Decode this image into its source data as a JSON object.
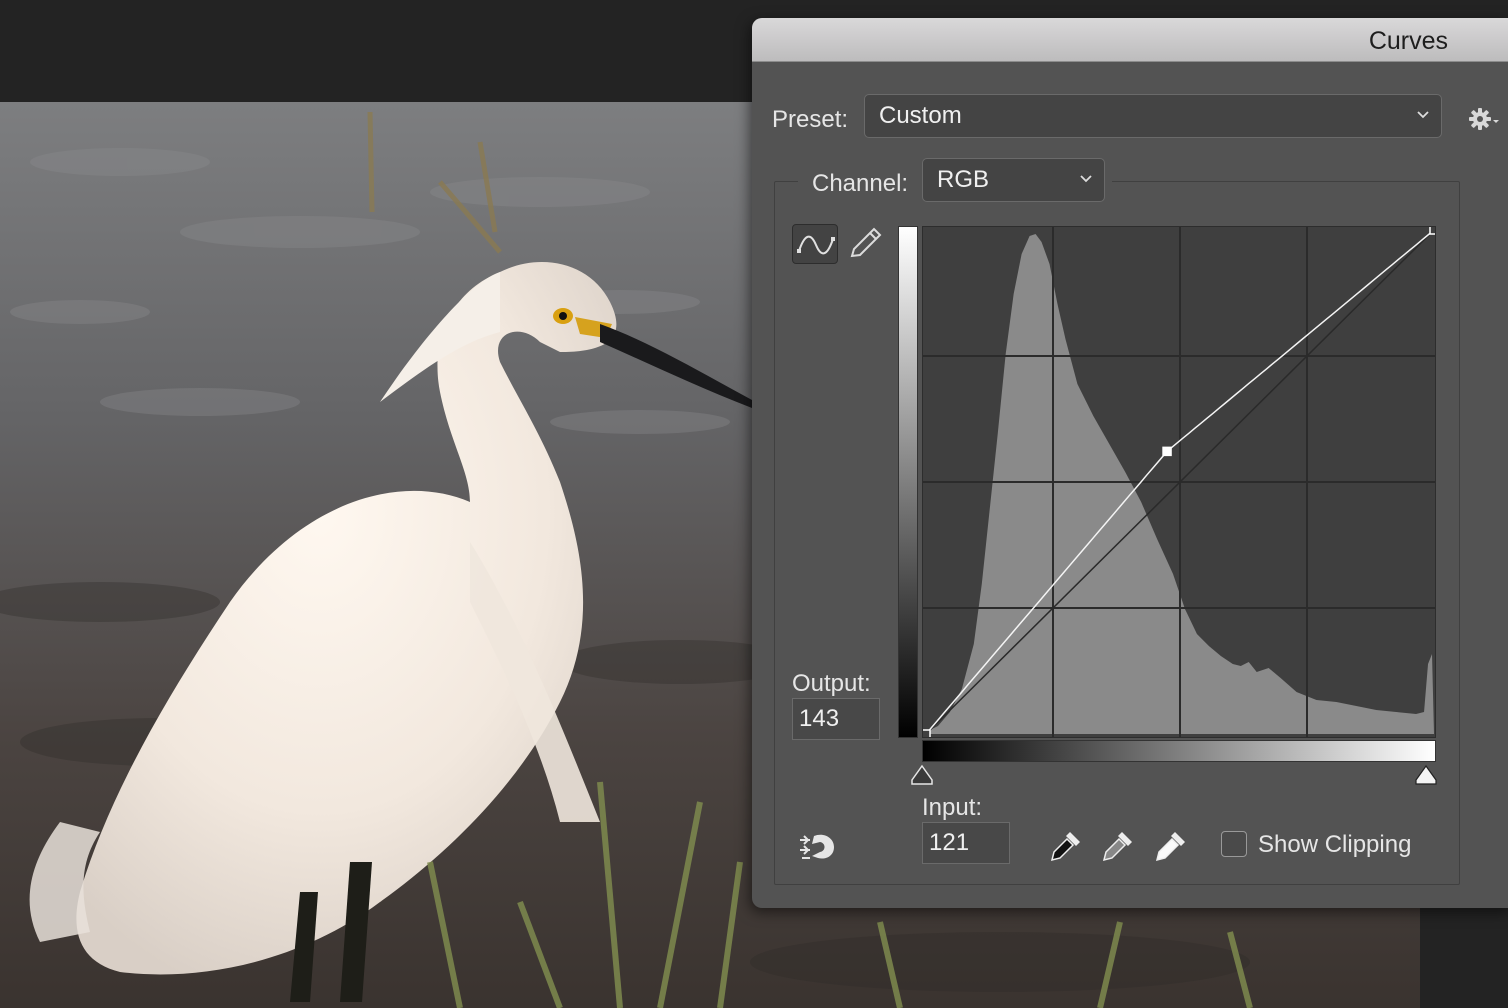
{
  "window": {
    "title": "Curves"
  },
  "preset": {
    "label": "Preset:",
    "value": "Custom"
  },
  "channel": {
    "label": "Channel:",
    "value": "RGB"
  },
  "tools": {
    "curve": "curve-point-tool",
    "pencil": "pencil-tool"
  },
  "output": {
    "label": "Output:",
    "value": "143"
  },
  "input": {
    "label": "Input:",
    "value": "121"
  },
  "eyedroppers": [
    "black-point-eyedropper",
    "gray-point-eyedropper",
    "white-point-eyedropper"
  ],
  "show_clipping": {
    "label": "Show Clipping",
    "checked": false
  },
  "curve": {
    "points": [
      [
        0,
        0
      ],
      [
        121,
        143
      ],
      [
        255,
        255
      ]
    ],
    "selected_point": 1
  },
  "colors": {
    "panel": "#535353",
    "graph_bg": "#3f3f3f",
    "histogram": "#8a8a8a",
    "grid": "#2b2b2b",
    "curve": "#f4f4f4"
  }
}
